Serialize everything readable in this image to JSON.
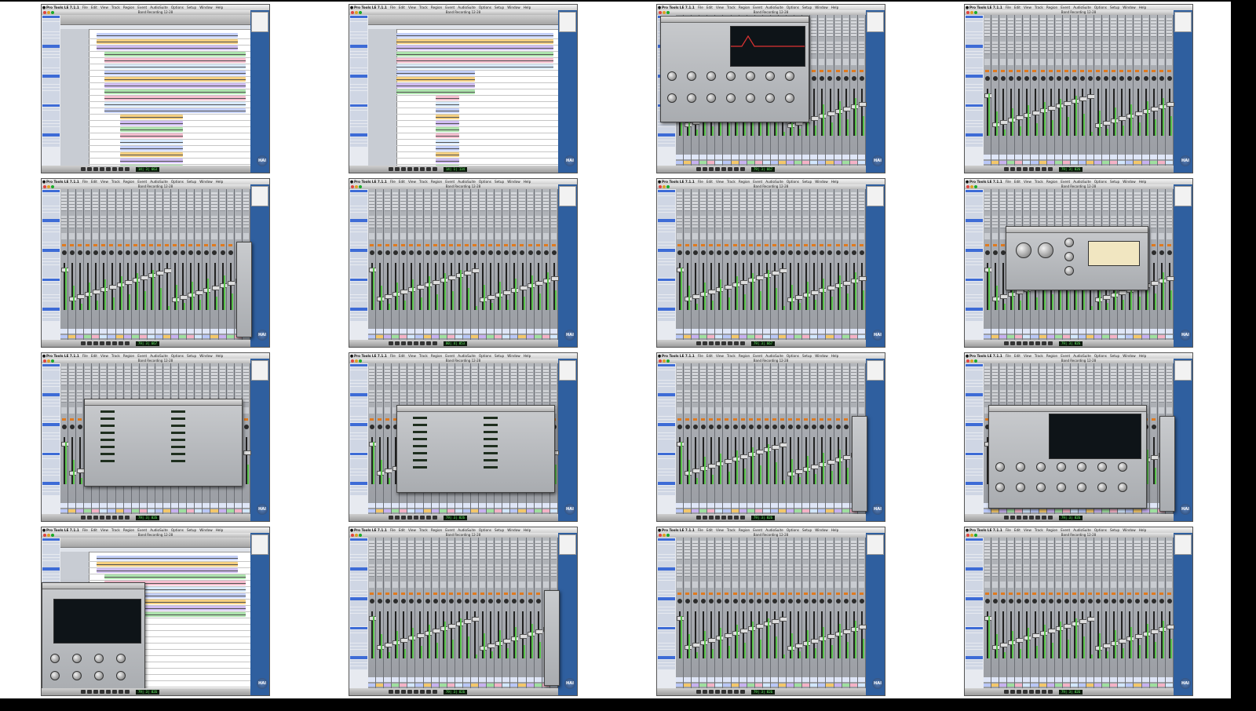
{
  "app": {
    "name": "Pro Tools LE 7.1.1",
    "menus": [
      "File",
      "Edit",
      "View",
      "Track",
      "Region",
      "Event",
      "AudioSuite",
      "Options",
      "Setup",
      "Window",
      "Help"
    ],
    "session_title": "Band Recording 12-28",
    "logo_text": "HAI"
  },
  "frames": [
    {
      "view": "edit",
      "counter": "14| 3| 663"
    },
    {
      "view": "edit2",
      "counter": "14| 1| 134"
    },
    {
      "view": "mixer-eq",
      "counter": "79| 3| 667"
    },
    {
      "view": "mixer",
      "counter": "79| 3| 826"
    },
    {
      "view": "mixer-strip",
      "counter": "79| 3| 667"
    },
    {
      "view": "mixer",
      "counter": "80| 4| 853"
    },
    {
      "view": "mixer",
      "counter": "79| 3| 667"
    },
    {
      "view": "mixer-comp",
      "counter": "79| 3| 826"
    },
    {
      "view": "mixer-delay",
      "counter": "79| 3| 826"
    },
    {
      "view": "mixer-delay2",
      "counter": "79| 3| 826"
    },
    {
      "view": "mixer-strip",
      "counter": "79| 3| 826"
    },
    {
      "view": "mixer-eq2",
      "counter": "79| 3| 826"
    },
    {
      "view": "edit-eq",
      "counter": "79| 3| 826"
    },
    {
      "view": "mixer-strip",
      "counter": "79| 3| 826"
    },
    {
      "view": "mixer",
      "counter": "79| 3| 826"
    },
    {
      "view": "mixer",
      "counter": "79| 3| 826"
    }
  ],
  "colors": {
    "background": "#000000",
    "desktop": "#2f5f9f",
    "selection": "#3d6bd6",
    "orange_button": "#e07a1f",
    "meter_green": "#58c24a",
    "clip_colors": [
      "#b9c7f7",
      "#f3c76a",
      "#c7b1f0",
      "#9fdf9f",
      "#f4b2c6",
      "#d2e7ff"
    ]
  }
}
